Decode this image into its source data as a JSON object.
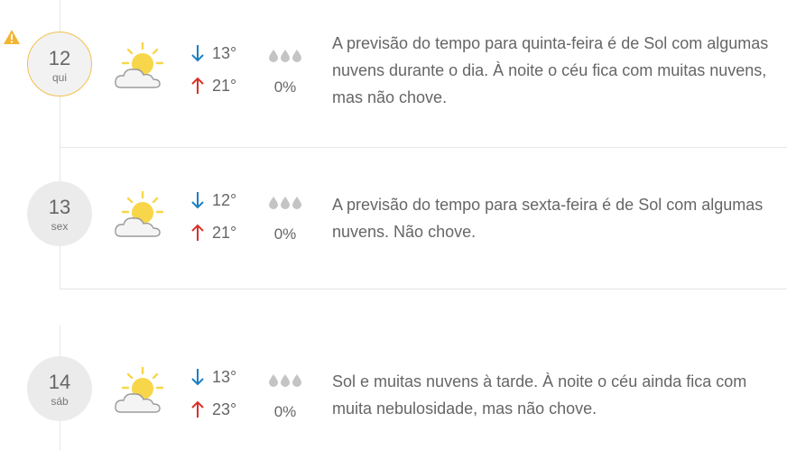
{
  "days": [
    {
      "day": "12",
      "weekday": "qui",
      "min": "13°",
      "max": "21°",
      "precip": "0%",
      "description": "A previsão do tempo para quinta-feira é de Sol com algumas nuvens durante o dia. À noite o céu fica com muitas nuvens, mas não chove.",
      "icon": "sun-cloud-icon",
      "alert": true
    },
    {
      "day": "13",
      "weekday": "sex",
      "min": "12°",
      "max": "21°",
      "precip": "0%",
      "description": "A previsão do tempo para sexta-feira é de Sol com algumas nuvens. Não chove.",
      "icon": "sun-cloud-icon",
      "alert": false
    },
    {
      "day": "14",
      "weekday": "sáb",
      "min": "13°",
      "max": "23°",
      "precip": "0%",
      "description": "Sol e muitas nuvens à tarde. À noite o céu ainda fica com muita nebulosidade, mas não chove.",
      "icon": "sun-cloud-icon",
      "alert": false
    }
  ],
  "colors": {
    "alert": "#f2b531",
    "min_arrow": "#1a7fc4",
    "max_arrow": "#d9302a",
    "sun": "#f7d64a",
    "drop": "#c4c4c4",
    "active_ring": "#f2c24e"
  }
}
